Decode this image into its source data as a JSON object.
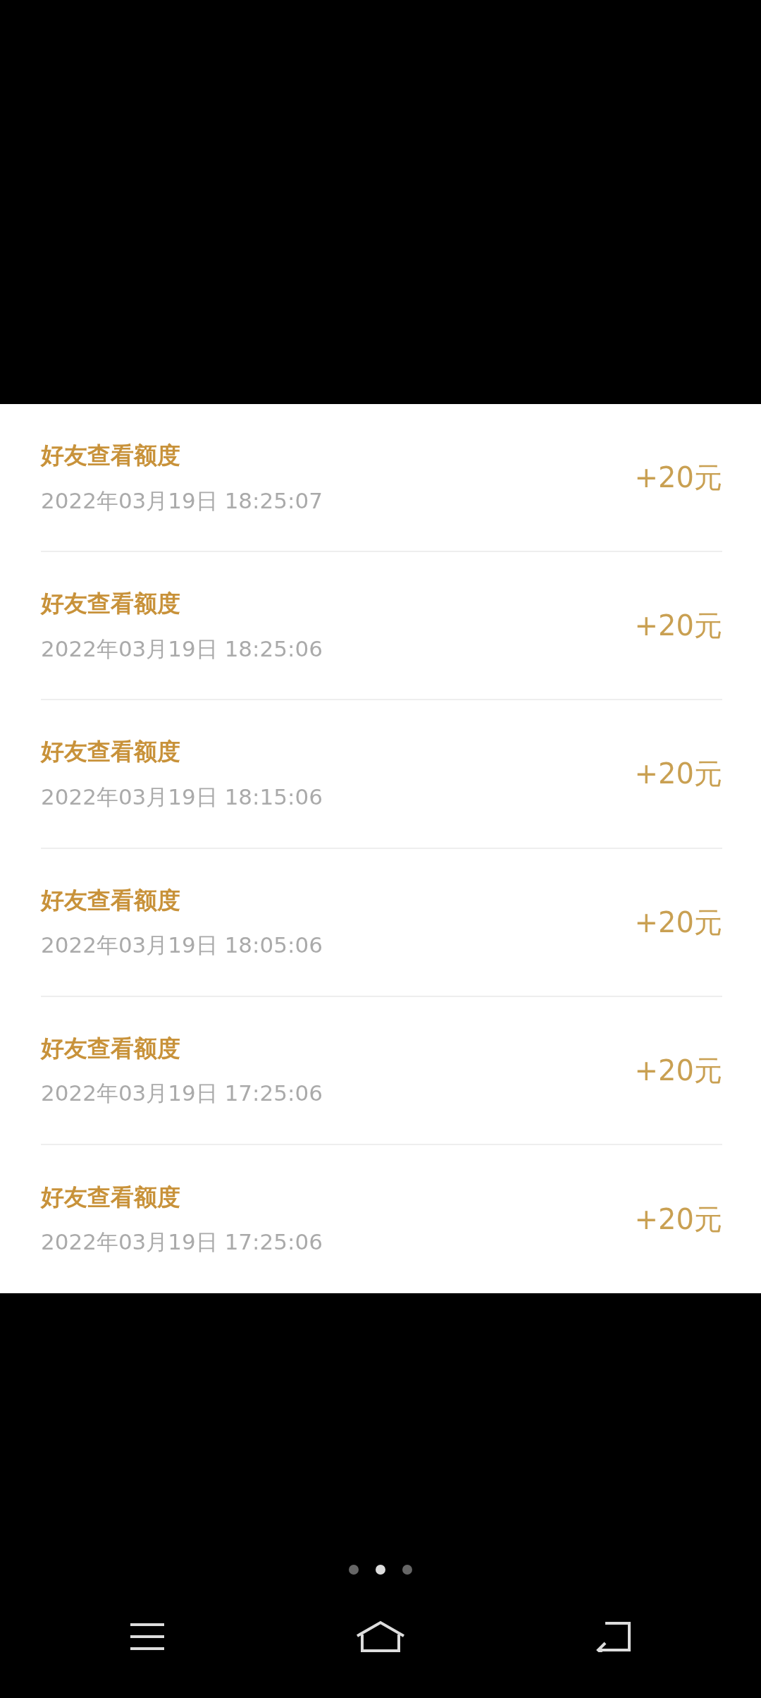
{
  "records": [
    {
      "title": "好友查看额度",
      "time": "2022年03月19日 18:25:07",
      "amount": "+20元"
    },
    {
      "title": "好友查看额度",
      "time": "2022年03月19日 18:25:06",
      "amount": "+20元"
    },
    {
      "title": "好友查看额度",
      "time": "2022年03月19日 18:15:06",
      "amount": "+20元"
    },
    {
      "title": "好友查看额度",
      "time": "2022年03月19日 18:05:06",
      "amount": "+20元"
    },
    {
      "title": "好友查看额度",
      "time": "2022年03月19日 17:25:06",
      "amount": "+20元"
    },
    {
      "title": "好友查看额度",
      "time": "2022年03月19日 17:25:06",
      "amount": "+20元"
    }
  ],
  "pager": [
    {
      "selected": false
    },
    {
      "selected": true
    },
    {
      "selected": false
    }
  ]
}
